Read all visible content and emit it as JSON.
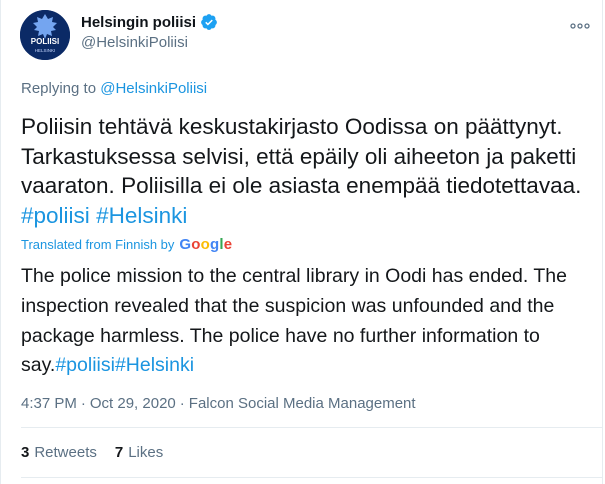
{
  "author": {
    "name": "Helsingin poliisi",
    "handle": "@HelsinkiPoliisi",
    "avatar_text": "POLIISI",
    "avatar_subtext": "HELSINKI"
  },
  "reply": {
    "prefix": "Replying to",
    "mention": "@HelsinkiPoliisi"
  },
  "original_text": {
    "body": "Poliisin tehtävä keskustakirjasto Oodissa on päättynyt. Tarkastuksessa selvisi, että epäily oli aiheeton ja paketti vaaraton. Poliisilla ei ole asiasta enempää tiedotettavaa.",
    "hashtag1": "#poliisi",
    "hashtag2": "#Helsinki"
  },
  "translation": {
    "label": "Translated from Finnish by",
    "provider": "Google",
    "body": "The police mission to the central library in Oodi has ended. The inspection revealed that the suspicion was unfounded and the package harmless. The police have no further information to say.",
    "hashtag1": "#poliisi",
    "hashtag2": "#Helsinki"
  },
  "meta": {
    "time": "4:37 PM",
    "sep1": "·",
    "date": "Oct 29, 2020",
    "sep2": "·",
    "source": "Falcon Social Media Management"
  },
  "stats": {
    "retweets_count": "3",
    "retweets_label": "Retweets",
    "likes_count": "7",
    "likes_label": "Likes"
  },
  "colors": {
    "link": "#1b95e0",
    "secondary_text": "#5b7083",
    "verified": "#1da1f2",
    "avatar_bg": "#0b2a66"
  },
  "icons": [
    "verified-badge-icon",
    "more-options-icon",
    "google-logo"
  ]
}
